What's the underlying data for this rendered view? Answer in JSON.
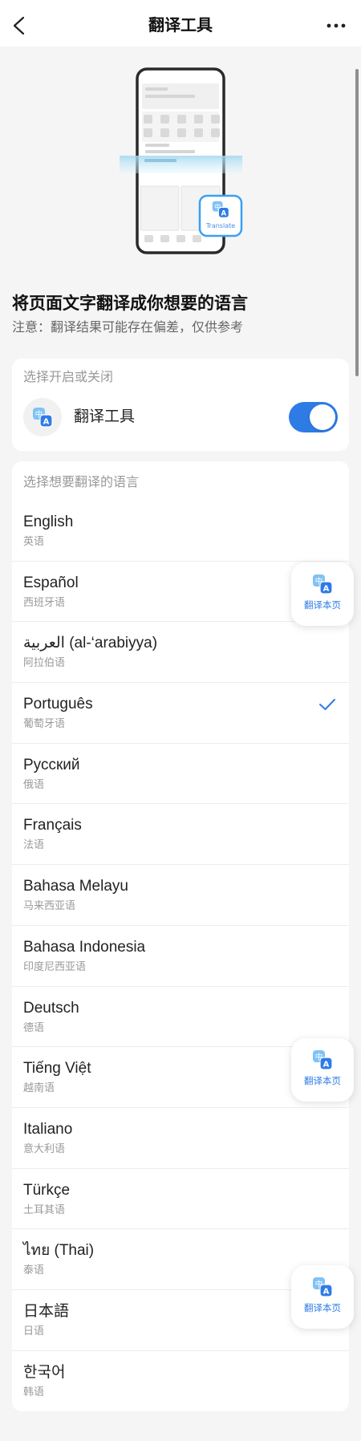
{
  "header": {
    "title": "翻译工具",
    "back_icon": "chevron-left-icon",
    "more_icon": "more-horizontal-icon"
  },
  "illustration": {
    "badge_label": "Translate"
  },
  "intro": {
    "title": "将页面文字翻译成你想要的语言",
    "note": "注意：翻译结果可能存在偏差，仅供参考"
  },
  "toggle_card": {
    "label": "选择开启或关闭",
    "icon": "translate-icon",
    "tool_name": "翻译工具",
    "enabled": true
  },
  "language_card": {
    "label": "选择想要翻译的语言",
    "selected_icon": "checkmark-icon",
    "languages": [
      {
        "name": "English",
        "label": "英语"
      },
      {
        "name": "Español",
        "label": "西班牙语"
      },
      {
        "name": "العربية (al-‘arabiyya)",
        "label": "阿拉伯语"
      },
      {
        "name": "Português",
        "label": "葡萄牙语",
        "selected": true
      },
      {
        "name": "Русский",
        "label": "俄语"
      },
      {
        "name": "Français",
        "label": "法语"
      },
      {
        "name": "Bahasa Melayu",
        "label": "马来西亚语"
      },
      {
        "name": "Bahasa Indonesia",
        "label": "印度尼西亚语"
      },
      {
        "name": "Deutsch",
        "label": "德语"
      },
      {
        "name": "Tiếng Việt",
        "label": "越南语"
      },
      {
        "name": "Italiano",
        "label": "意大利语"
      },
      {
        "name": "Türkçe",
        "label": "土耳其语"
      },
      {
        "name": "ไทย (Thai)",
        "label": "泰语"
      },
      {
        "name": "日本語",
        "label": "日语"
      },
      {
        "name": "한국어",
        "label": "韩语"
      }
    ]
  },
  "floating_buttons": [
    {
      "label": "翻译本页",
      "icon": "translate-icon"
    },
    {
      "label": "翻译本页",
      "icon": "translate-icon"
    },
    {
      "label": "翻译本页",
      "icon": "translate-icon"
    }
  ],
  "translate_icon": {
    "glyph_zh": "中",
    "glyph_en": "A"
  },
  "colors": {
    "accent": "#2e7be6",
    "background": "#f5f5f5",
    "card": "#ffffff",
    "text_primary": "#222222",
    "text_secondary": "#999999"
  }
}
